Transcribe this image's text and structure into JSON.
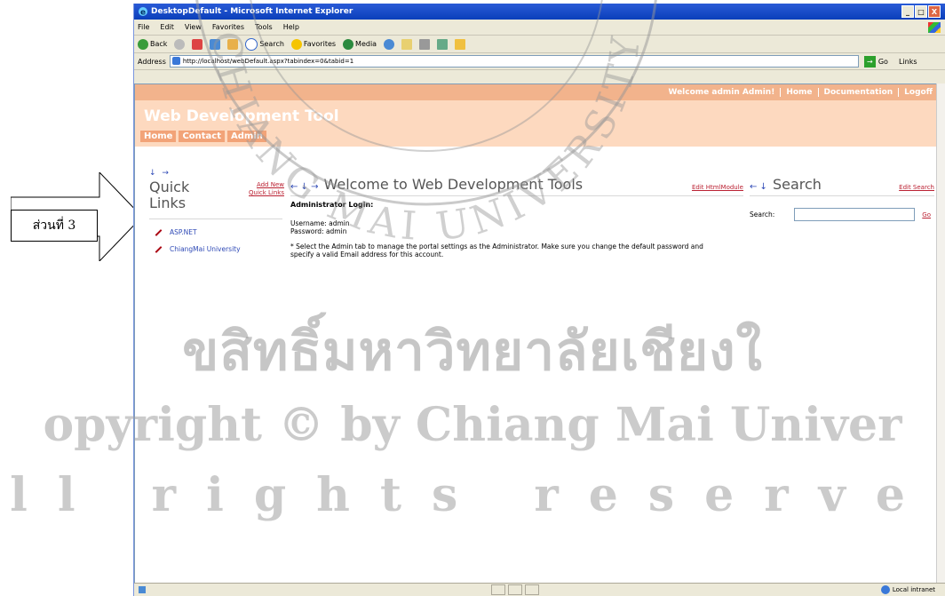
{
  "annotation": {
    "label": "ส่วนที่ 3"
  },
  "browser": {
    "title": "DesktopDefault - Microsoft Internet Explorer",
    "window_buttons": [
      "_",
      "□",
      "X"
    ],
    "menu": [
      "File",
      "Edit",
      "View",
      "Favorites",
      "Tools",
      "Help"
    ],
    "toolbar": {
      "back": "Back",
      "search": "Search",
      "favorites": "Favorites",
      "media": "Media"
    },
    "address_label": "Address",
    "address_value": "http://localhost/webDefault.aspx?tabindex=0&tabid=1",
    "go_label": "Go",
    "links_label": "Links",
    "status_zone": "Local intranet"
  },
  "page": {
    "topnav": {
      "welcome": "Welcome admin Admin!",
      "items": [
        "Home",
        "Documentation",
        "Logoff"
      ]
    },
    "banner_title": "Web Development Tool",
    "tabs": [
      "Home",
      "Contact",
      "Admin"
    ],
    "quick_links": {
      "arrows": "↓ →",
      "title_line1": "Quick",
      "title_line2": "Links",
      "add_new": "Add New Quick Links",
      "items": [
        "ASP.NET",
        "ChiangMai University"
      ]
    },
    "welcome_module": {
      "arrows": "← ↓ →",
      "title": "Welcome to Web Development Tools",
      "edit": "Edit HtmlModule",
      "heading": "Administrator Login:",
      "username": "Username: admin",
      "password": "Password: admin",
      "note": "* Select the Admin tab to manage the portal settings as the Administrator. Make sure you change the default password and specify a valid Email address for this account."
    },
    "search_module": {
      "arrows": "← ↓",
      "title": "Search",
      "edit": "Edit Search",
      "label": "Search:",
      "go": "Go"
    }
  },
  "watermark": {
    "line1": "ขสิทธิ์มหาวิทยาลัยเชียงใ",
    "line2": "opyright © by Chiang Mai Univer",
    "line3": "ll rights reserve",
    "seal_text": "CHIANG MAI UNIVERSITY"
  }
}
